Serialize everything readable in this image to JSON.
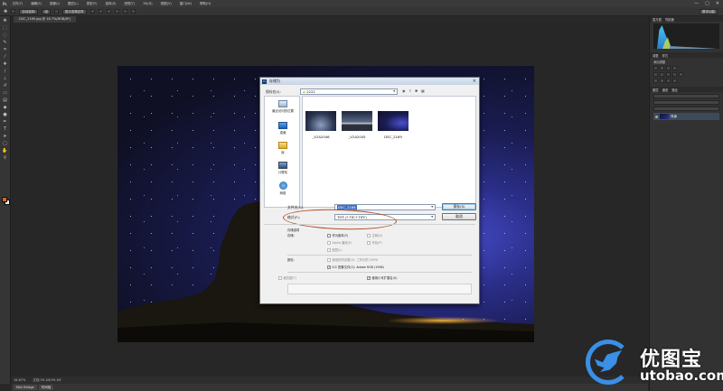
{
  "app": {
    "logo": "Ps",
    "menu": [
      "文件(F)",
      "编辑(E)",
      "图像(I)",
      "图层(L)",
      "类型(Y)",
      "选择(S)",
      "滤镜(T)",
      "3D(D)",
      "视图(V)",
      "窗口(W)",
      "帮助(H)"
    ],
    "window_controls": [
      "—",
      "▢",
      "✕"
    ]
  },
  "options_bar": {
    "mode_label": "自动选择:",
    "mode_value": "组",
    "transform_label": "显示变换控件",
    "workspace": "基本功能"
  },
  "document": {
    "tab": "DSC_2169.jpg @ 16.7%(RGB/8*)",
    "zoom": "16.67%",
    "doc_info": "文档:39.1M/39.1M",
    "bottom_tabs": [
      "Mini Bridge",
      "时间轴"
    ]
  },
  "panels": {
    "histogram_tabs": [
      "直方图",
      "导航器"
    ],
    "adjust_tabs": [
      "调整",
      "样式"
    ],
    "adjust_add": "添加调整",
    "layer_tabs": [
      "图层",
      "通道",
      "路径"
    ],
    "layer_name": "背景"
  },
  "dialog": {
    "title": "存储为",
    "save_in_label": "保存在(I):",
    "folder": "2222",
    "places": [
      {
        "label": "最近访问的位置",
        "icon": "recent-places-icon"
      },
      {
        "label": "桌面",
        "icon": "desktop-icon"
      },
      {
        "label": "库",
        "icon": "libraries-icon"
      },
      {
        "label": "计算机",
        "icon": "computer-icon"
      },
      {
        "label": "网络",
        "icon": "network-icon"
      }
    ],
    "files": [
      {
        "name": "_V2A2046"
      },
      {
        "name": "_V2A2045"
      },
      {
        "name": "DSC_2169"
      }
    ],
    "filename_label": "文件名(N):",
    "filename": "DSC_2169",
    "format_label": "格式(F):",
    "format": "TIFF (*.TIF;*.TIFF)",
    "save_button": "保存(S)",
    "cancel_button": "取消",
    "storage_options_label": "存储选项",
    "storage_label": "存储:",
    "storage_checks": [
      {
        "label": "作为副本(Y)",
        "checked": false,
        "enabled": true
      },
      {
        "label": "注释(N)",
        "checked": false,
        "enabled": false
      },
      {
        "label": "Alpha 通道(E)",
        "checked": false,
        "enabled": false
      },
      {
        "label": "专色(P)",
        "checked": false,
        "enabled": false
      },
      {
        "label": "图层(L)",
        "checked": false,
        "enabled": false
      }
    ],
    "color_label": "颜色:",
    "color_checks": [
      {
        "label": "使用校样设置(O): 工作中的 CMYK",
        "checked": false,
        "enabled": false
      },
      {
        "label": "ICC 配置文件(C): Adobe RGB (1998)",
        "checked": true,
        "enabled": true
      }
    ],
    "thumbnail_label": "缩览图(T)",
    "lowercase_label": "使用小写扩展名(U)",
    "lowercase_checked": true
  },
  "watermark": {
    "chinese": "优图宝",
    "domain": "utobao.com"
  },
  "colors": {
    "foreground": "#d0691f",
    "annotation": "#b2502a",
    "watermark": "#3a8fe6"
  }
}
